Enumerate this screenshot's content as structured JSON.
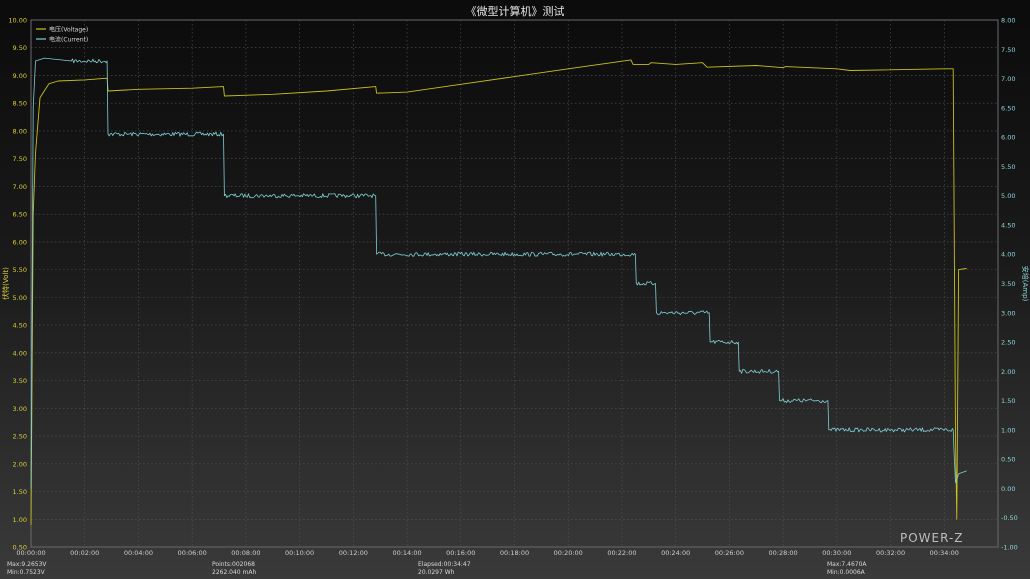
{
  "chart_data": {
    "type": "line",
    "title": "《微型计算机》测试",
    "xlabel": "",
    "ylabel_left": "伏特(Volt)",
    "ylabel_right": "安培(Amp)",
    "x_ticks": [
      "00:00:00",
      "00:02:00",
      "00:04:00",
      "00:06:00",
      "00:08:00",
      "00:10:00",
      "00:12:00",
      "00:14:00",
      "00:16:00",
      "00:18:00",
      "00:20:00",
      "00:22:00",
      "00:24:00",
      "00:26:00",
      "00:28:00",
      "00:30:00",
      "00:32:00",
      "00:34:00"
    ],
    "x_range_seconds": [
      0,
      2160
    ],
    "y_left_range": [
      0.5,
      10.0
    ],
    "y_left_ticks": [
      "10.00",
      "9.50",
      "9.00",
      "8.50",
      "8.00",
      "7.50",
      "7.00",
      "6.50",
      "6.00",
      "5.50",
      "5.00",
      "4.50",
      "4.00",
      "3.50",
      "3.00",
      "2.50",
      "2.00",
      "1.50",
      "1.00",
      "0.50"
    ],
    "y_right_range": [
      -1.0,
      8.0
    ],
    "y_right_ticks": [
      "8.00",
      "7.50",
      "7.00",
      "6.50",
      "6.00",
      "5.50",
      "5.00",
      "4.50",
      "4.00",
      "3.50",
      "3.00",
      "2.50",
      "2.00",
      "1.50",
      "1.00",
      "0.50",
      "0.00",
      "-0.50",
      "-1.00"
    ],
    "grid": true,
    "legend_position": "top-left",
    "series": [
      {
        "name": "电压(Voltage)",
        "axis": "left",
        "color": "#c9bf1e",
        "points": [
          [
            "00:00:00",
            0.9
          ],
          [
            "00:00:05",
            6.5
          ],
          [
            "00:00:10",
            7.6
          ],
          [
            "00:00:20",
            8.6
          ],
          [
            "00:00:40",
            8.85
          ],
          [
            "00:01:00",
            8.9
          ],
          [
            "00:02:00",
            8.92
          ],
          [
            "00:02:50",
            8.95
          ],
          [
            "00:02:52",
            8.72
          ],
          [
            "00:04:00",
            8.75
          ],
          [
            "00:06:00",
            8.77
          ],
          [
            "00:07:10",
            8.8
          ],
          [
            "00:07:12",
            8.63
          ],
          [
            "00:09:00",
            8.66
          ],
          [
            "00:11:00",
            8.72
          ],
          [
            "00:12:50",
            8.8
          ],
          [
            "00:12:52",
            8.68
          ],
          [
            "00:14:00",
            8.7
          ],
          [
            "00:16:00",
            8.84
          ],
          [
            "00:18:00",
            8.98
          ],
          [
            "00:20:00",
            9.12
          ],
          [
            "00:22:20",
            9.28
          ],
          [
            "00:22:25",
            9.2
          ],
          [
            "00:23:00",
            9.2
          ],
          [
            "00:23:05",
            9.23
          ],
          [
            "00:24:00",
            9.2
          ],
          [
            "00:25:00",
            9.23
          ],
          [
            "00:25:10",
            9.15
          ],
          [
            "00:27:00",
            9.18
          ],
          [
            "00:28:00",
            9.14
          ],
          [
            "00:28:05",
            9.16
          ],
          [
            "00:30:00",
            9.12
          ],
          [
            "00:30:30",
            9.09
          ],
          [
            "00:34:00",
            9.12
          ],
          [
            "00:34:20",
            9.12
          ],
          [
            "00:34:25",
            2.5
          ],
          [
            "00:34:28",
            1.0
          ],
          [
            "00:34:32",
            5.5
          ],
          [
            "00:34:50",
            5.52
          ]
        ]
      },
      {
        "name": "电流(Current)",
        "axis": "right",
        "color": "#7fcfd4",
        "points": [
          [
            "00:00:00",
            0.0
          ],
          [
            "00:00:05",
            6.5
          ],
          [
            "00:00:10",
            7.3
          ],
          [
            "00:00:30",
            7.35
          ],
          [
            "00:01:30",
            7.3
          ],
          [
            "00:02:50",
            7.3
          ],
          [
            "00:02:52",
            6.05
          ],
          [
            "00:07:10",
            6.05
          ],
          [
            "00:07:12",
            5.0
          ],
          [
            "00:12:50",
            5.0
          ],
          [
            "00:12:52",
            4.0
          ],
          [
            "00:22:30",
            4.0
          ],
          [
            "00:22:32",
            3.5
          ],
          [
            "00:23:15",
            3.5
          ],
          [
            "00:23:17",
            3.0
          ],
          [
            "00:25:15",
            3.0
          ],
          [
            "00:25:17",
            2.5
          ],
          [
            "00:26:20",
            2.5
          ],
          [
            "00:26:22",
            2.0
          ],
          [
            "00:27:50",
            2.0
          ],
          [
            "00:27:52",
            1.5
          ],
          [
            "00:29:40",
            1.5
          ],
          [
            "00:29:42",
            1.0
          ],
          [
            "00:34:20",
            1.0
          ],
          [
            "00:34:22",
            0.6
          ],
          [
            "00:34:25",
            0.1
          ],
          [
            "00:34:28",
            0.15
          ],
          [
            "00:34:32",
            0.25
          ],
          [
            "00:34:50",
            0.3
          ]
        ]
      }
    ]
  },
  "legend": {
    "voltage": "电压(Voltage)",
    "current": "电流(Current)"
  },
  "stats": {
    "voltage_max": "Max:9.2653V",
    "voltage_min": "Min:0.7523V",
    "points": "Points:002068",
    "capacity": "2262.040 mAh",
    "elapsed": "Elapsed:00:34:47",
    "energy": "20.0297 Wh",
    "current_max": "Max:7.4670A",
    "current_min": "Min:0.0006A"
  },
  "watermark": "POWER-Z"
}
